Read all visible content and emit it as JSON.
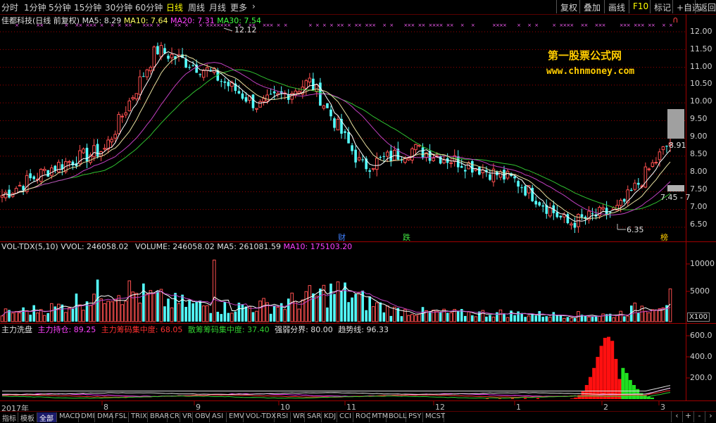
{
  "toolbar": {
    "periods": [
      "分时",
      "1分钟",
      "5分钟",
      "15分钟",
      "30分钟",
      "60分钟",
      "日线",
      "周线",
      "月线",
      "更多"
    ],
    "more_arrow": "›",
    "active_period": "日线",
    "right_buttons": [
      "复权",
      "叠加",
      "画线",
      "F10",
      "标记",
      "+自选",
      "返回"
    ]
  },
  "price_panel": {
    "stock_title": "佳都科技(日线 前复权)",
    "ma5": "MA5: 8.29",
    "ma10": "MA10: 7.64",
    "ma20": "MA20: 7.31",
    "ma30": "MA30: 7.54",
    "high_label": "12.12",
    "low_label": "6.35",
    "last_high": "8.91",
    "range_label": "7.45 - 7",
    "marker_cai": "财",
    "marker_die": "跌",
    "marker_bang": "榜",
    "watermark_line1": "第一股票公式网",
    "watermark_line2": "www.chnmoney.com",
    "corner_marker": "∩",
    "y_ticks": [
      "12.00",
      "11.50",
      "11.00",
      "10.50",
      "10.00",
      "9.50",
      "9.00",
      "8.50",
      "8.00",
      "7.50",
      "7.00",
      "6.50"
    ]
  },
  "volume_panel": {
    "name": "VOL-TDX(5,10)",
    "vvol": "VVOL: 246058.02",
    "volume": "VOLUME: 246058.02",
    "ma5": "MA5: 261081.59",
    "ma10": "MA10: 175103.20",
    "y_ticks": [
      "10000",
      "5000"
    ],
    "unit": "X100"
  },
  "indicator_panel": {
    "name": "主力洗盘",
    "hold": "主力持仓: 89.25",
    "concentration": "主力筹码集中度: 68.05",
    "retail": "散筹筹码集中度: 37.40",
    "strength": "强弱分界: 80.00",
    "trend": "趋势线: 96.33",
    "y_ticks": [
      "600.0",
      "400.0",
      "200.0"
    ]
  },
  "x_axis": {
    "months": [
      "2017年",
      "8",
      "9",
      "10",
      "11",
      "12",
      "1",
      "2",
      "3"
    ]
  },
  "tabs": [
    "指标",
    "模板",
    "全部",
    "MACD",
    "DMI",
    "DMA",
    "FSL",
    "TRIX",
    "BRAR",
    "CR",
    "VR",
    "OBV",
    "ASI",
    "EMV",
    "VOL-TDX",
    "RSI",
    "WR",
    "SAR",
    "KDJ",
    "CCI",
    "ROC",
    "MTM",
    "BOLL",
    "PSY",
    "MCST"
  ],
  "active_tab": "全部",
  "nav_buttons": [
    "‹",
    "+",
    "-",
    "›"
  ],
  "chart_data": {
    "type": "candlestick",
    "y_range": [
      6.2,
      12.3
    ],
    "dates": [
      "2017-07",
      "2017-08",
      "2017-09",
      "2017-10",
      "2017-11",
      "2017-12",
      "2018-01",
      "2018-02",
      "2018-03"
    ],
    "close_trend": [
      7.4,
      8.2,
      8.7,
      11.5,
      10.9,
      9.9,
      10.6,
      8.2,
      8.7,
      8.3,
      7.8,
      6.6,
      7.0,
      8.9
    ],
    "volume_trend": [
      1500,
      2500,
      6000,
      3500,
      2500,
      3000,
      5500,
      2000,
      1500,
      1500,
      1200,
      1200,
      4000
    ]
  }
}
